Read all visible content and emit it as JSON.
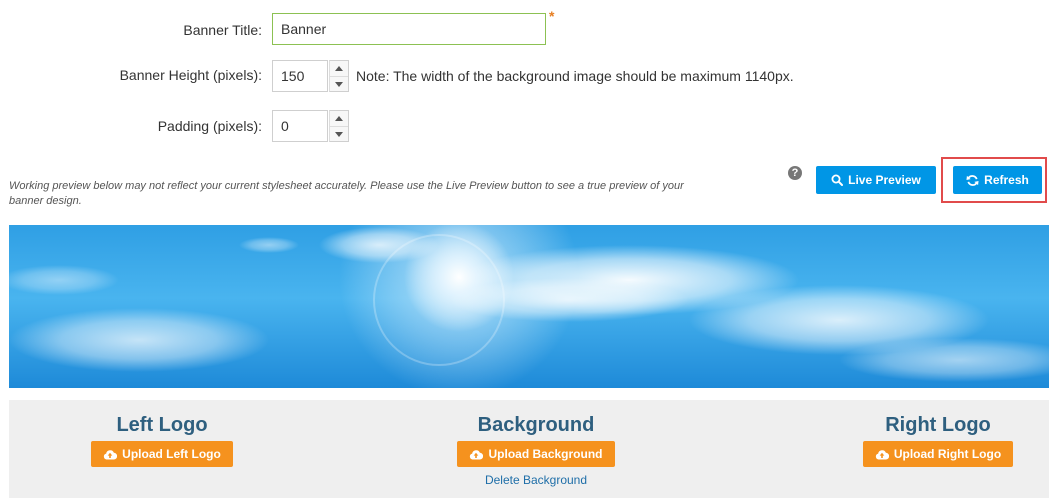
{
  "form": {
    "banner_title_label": "Banner Title:",
    "banner_title_value": "Banner",
    "required_marker": "*",
    "banner_height_label": "Banner Height (pixels):",
    "banner_height_value": "150",
    "banner_height_note": "Note: The width of the background image should be maximum 1140px.",
    "padding_label": "Padding (pixels):",
    "padding_value": "0"
  },
  "preview": {
    "warning": "Working preview below may not reflect your current stylesheet accurately. Please use the Live Preview button to see a true preview of your banner design.",
    "help_icon": "?",
    "live_preview_label": "Live Preview",
    "refresh_label": "Refresh",
    "highlight_color": "#e14b4b"
  },
  "logos": {
    "left_title": "Left Logo",
    "left_button": "Upload Left Logo",
    "background_title": "Background",
    "background_button": "Upload Background",
    "delete_background": "Delete Background",
    "right_title": "Right Logo",
    "right_button": "Upload Right Logo"
  },
  "colors": {
    "accent_blue": "#0096e6",
    "accent_orange": "#f5921e",
    "title_color": "#2e5f7f"
  }
}
